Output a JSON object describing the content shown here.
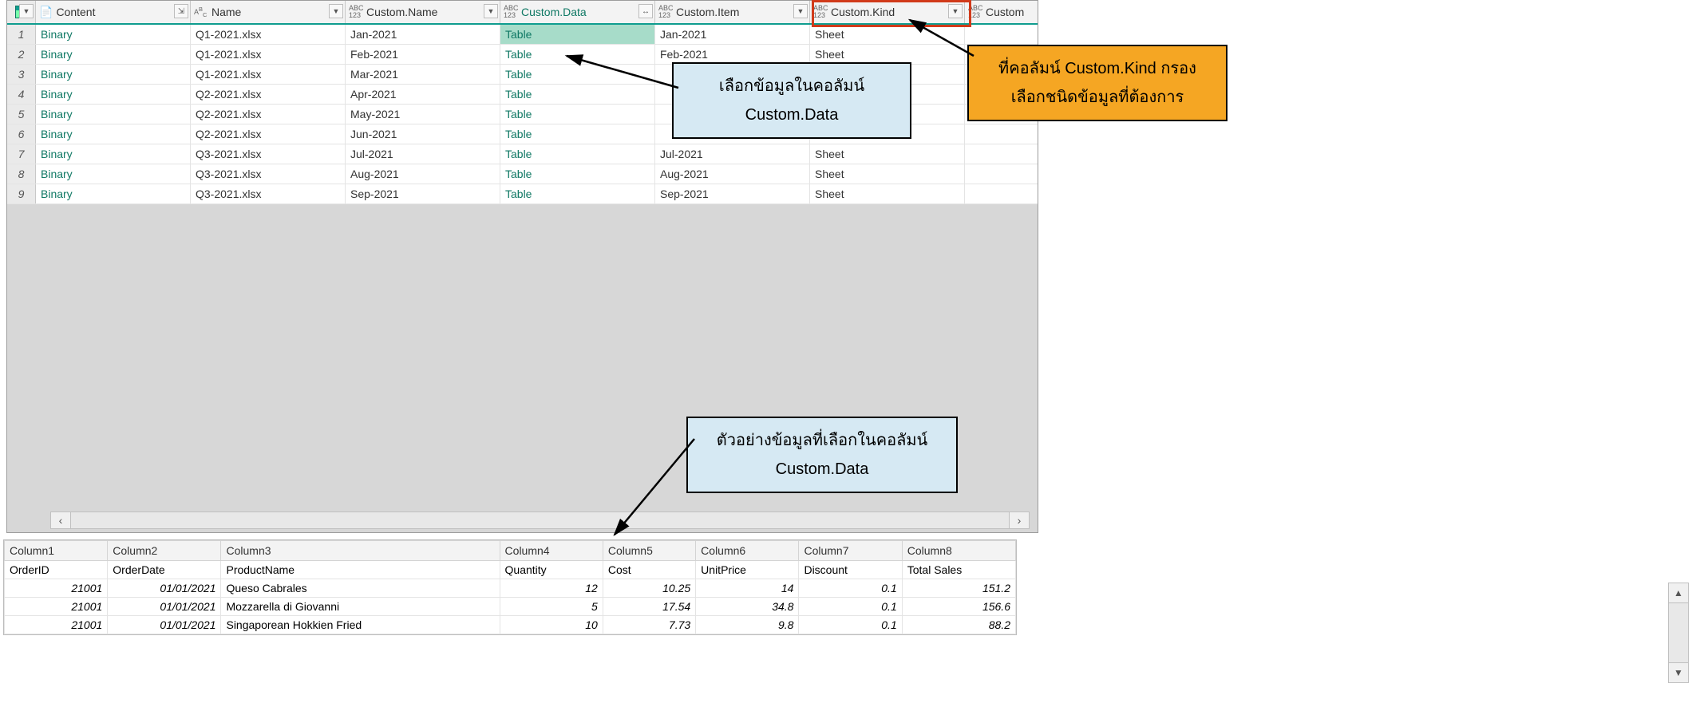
{
  "columns": {
    "content": "Content",
    "name": "Name",
    "customName": "Custom.Name",
    "customData": "Custom.Data",
    "customItem": "Custom.Item",
    "customKind": "Custom.Kind",
    "extra": "Custom"
  },
  "rows": [
    {
      "n": "1",
      "content": "Binary",
      "name": "Q1-2021.xlsx",
      "cname": "Jan-2021",
      "cdata": "Table",
      "citem": "Jan-2021",
      "ckind": "Sheet"
    },
    {
      "n": "2",
      "content": "Binary",
      "name": "Q1-2021.xlsx",
      "cname": "Feb-2021",
      "cdata": "Table",
      "citem": "Feb-2021",
      "ckind": "Sheet"
    },
    {
      "n": "3",
      "content": "Binary",
      "name": "Q1-2021.xlsx",
      "cname": "Mar-2021",
      "cdata": "Table",
      "citem": "",
      "ckind": ""
    },
    {
      "n": "4",
      "content": "Binary",
      "name": "Q2-2021.xlsx",
      "cname": "Apr-2021",
      "cdata": "Table",
      "citem": "",
      "ckind": ""
    },
    {
      "n": "5",
      "content": "Binary",
      "name": "Q2-2021.xlsx",
      "cname": "May-2021",
      "cdata": "Table",
      "citem": "",
      "ckind": ""
    },
    {
      "n": "6",
      "content": "Binary",
      "name": "Q2-2021.xlsx",
      "cname": "Jun-2021",
      "cdata": "Table",
      "citem": "",
      "ckind": ""
    },
    {
      "n": "7",
      "content": "Binary",
      "name": "Q3-2021.xlsx",
      "cname": "Jul-2021",
      "cdata": "Table",
      "citem": "Jul-2021",
      "ckind": "Sheet"
    },
    {
      "n": "8",
      "content": "Binary",
      "name": "Q3-2021.xlsx",
      "cname": "Aug-2021",
      "cdata": "Table",
      "citem": "Aug-2021",
      "ckind": "Sheet"
    },
    {
      "n": "9",
      "content": "Binary",
      "name": "Q3-2021.xlsx",
      "cname": "Sep-2021",
      "cdata": "Table",
      "citem": "Sep-2021",
      "ckind": "Sheet"
    }
  ],
  "callouts": {
    "blue1_l1": "เลือกข้อมูลในคอลัมน์",
    "blue1_l2": "Custom.Data",
    "blue2_l1": "ตัวอย่างข้อมูลที่เลือกในคอลัมน์",
    "blue2_l2": "Custom.Data",
    "orange_l1": "ที่คอลัมน์ Custom.Kind กรอง",
    "orange_l2": "เลือกชนิดข้อมูลที่ต้องการ"
  },
  "preview": {
    "headers": [
      "Column1",
      "Column2",
      "Column3",
      "Column4",
      "Column5",
      "Column6",
      "Column7",
      "Column8"
    ],
    "subheaders": [
      "OrderID",
      "OrderDate",
      "ProductName",
      "Quantity",
      "Cost",
      "UnitPrice",
      "Discount",
      "Total Sales"
    ],
    "rows": [
      [
        "21001",
        "01/01/2021",
        "Queso Cabrales",
        "12",
        "10.25",
        "14",
        "0.1",
        "151.2"
      ],
      [
        "21001",
        "01/01/2021",
        "Mozzarella di Giovanni",
        "5",
        "17.54",
        "34.8",
        "0.1",
        "156.6"
      ],
      [
        "21001",
        "01/01/2021",
        "Singaporean Hokkien Fried",
        "10",
        "7.73",
        "9.8",
        "0.1",
        "88.2"
      ]
    ]
  }
}
